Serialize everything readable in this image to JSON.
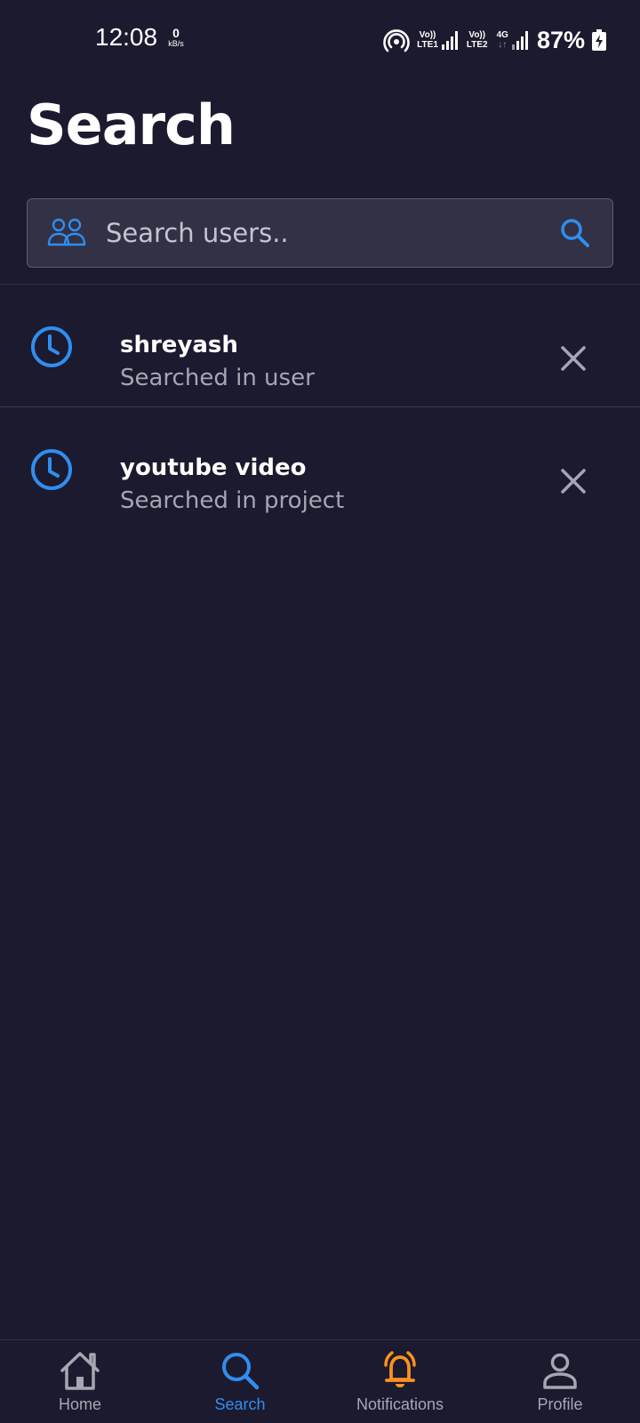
{
  "status_bar": {
    "time": "12:08",
    "net_speed_value": "0",
    "net_speed_unit": "kB/s",
    "sim1_top": "Vo))",
    "sim1_bottom": "LTE1",
    "sim2_top": "Vo))",
    "sim2_bottom": "LTE2",
    "sim2_network": "4G",
    "battery": "87%"
  },
  "page": {
    "title": "Search"
  },
  "search": {
    "placeholder": "Search users..",
    "value": ""
  },
  "history": [
    {
      "title": "shreyash",
      "subtitle": "Searched in user"
    },
    {
      "title": "youtube video",
      "subtitle": "Searched in project"
    }
  ],
  "bottom_nav": {
    "items": [
      {
        "label": "Home",
        "icon": "home-icon",
        "active": false
      },
      {
        "label": "Search",
        "icon": "search-icon",
        "active": true
      },
      {
        "label": "Notifications",
        "icon": "bell-ringing-icon",
        "active": false
      },
      {
        "label": "Profile",
        "icon": "person-icon",
        "active": false
      }
    ]
  },
  "colors": {
    "background": "#1c1a2e",
    "accent_blue": "#2f8ef0",
    "notification_orange": "#f7931e",
    "search_box": "#333146"
  }
}
